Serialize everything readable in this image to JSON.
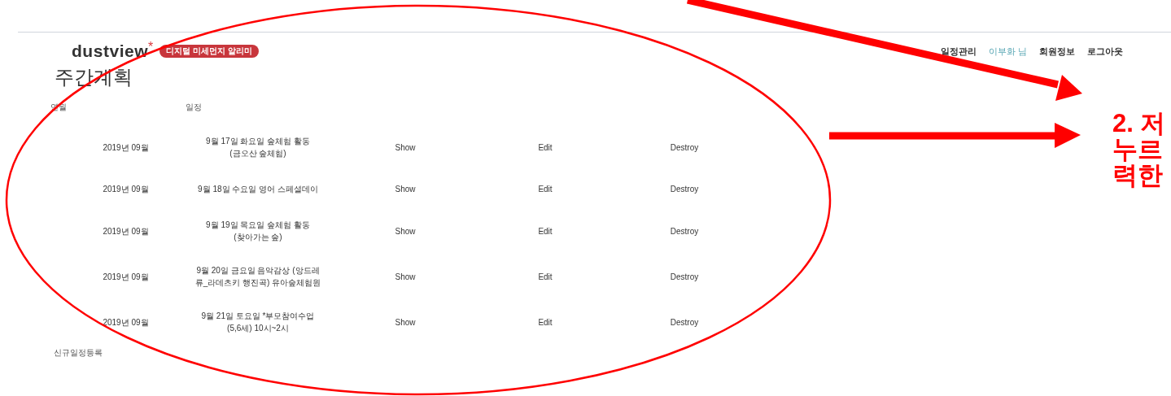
{
  "header": {
    "logo": "dustview",
    "logo_mark": "*",
    "badge": "디지털 미세먼지 알리미",
    "nav": [
      {
        "label": "일정관리",
        "kind": "link"
      },
      {
        "label": "이부화 님",
        "kind": "user"
      },
      {
        "label": "회원정보",
        "kind": "link"
      },
      {
        "label": "로그아웃",
        "kind": "link"
      }
    ]
  },
  "title": "주간계획",
  "table": {
    "columns": [
      "연월",
      "일정"
    ],
    "rows": [
      {
        "month": "2019년 09월",
        "schedule": [
          "9월 17일 화요일 숲체험 활동",
          "(금오산 숲체험)"
        ],
        "actions": [
          "Show",
          "Edit",
          "Destroy"
        ]
      },
      {
        "month": "2019년 09월",
        "schedule": [
          "9월 18일 수요일 영어 스페셜데이"
        ],
        "actions": [
          "Show",
          "Edit",
          "Destroy"
        ]
      },
      {
        "month": "2019년 09월",
        "schedule": [
          "9월 19일 목요일 숲체험 활동",
          "(찾아가는 숲)"
        ],
        "actions": [
          "Show",
          "Edit",
          "Destroy"
        ]
      },
      {
        "month": "2019년 09월",
        "schedule": [
          "9월 20일 금요일 음악감상 (앙드레",
          "류_라데츠키 행진곡) 유아숲체험원"
        ],
        "actions": [
          "Show",
          "Edit",
          "Destroy"
        ]
      },
      {
        "month": "2019년 09월",
        "schedule": [
          "9월 21일 토요일 *부모참여수업",
          "(5,6세) 10시~2시"
        ],
        "actions": [
          "Show",
          "Edit",
          "Destroy"
        ]
      }
    ]
  },
  "new_link": "신규일정등록",
  "annotation": {
    "lines": [
      "2. 저",
      "누르",
      "력한"
    ]
  }
}
